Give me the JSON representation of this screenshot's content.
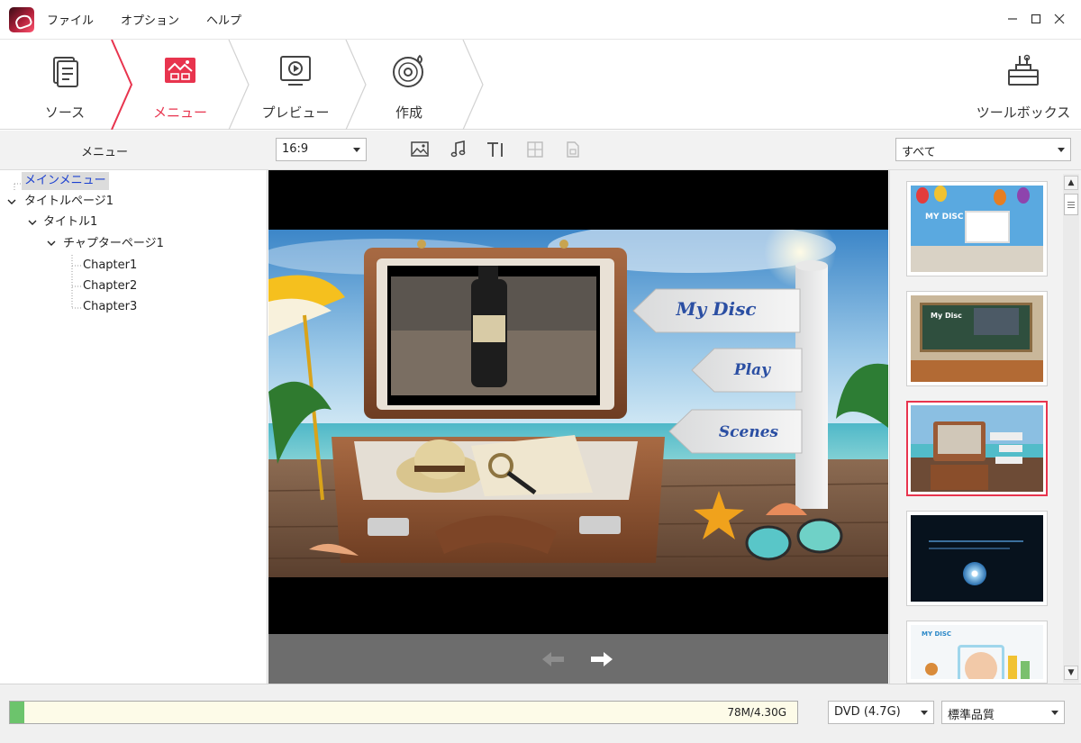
{
  "menu": {
    "file": "ファイル",
    "options": "オプション",
    "help": "ヘルプ"
  },
  "steps": {
    "source": "ソース",
    "menu": "メニュー",
    "preview": "プレビュー",
    "create": "作成",
    "toolbox": "ツールボックス",
    "active": "menu"
  },
  "left_panel": {
    "title": "メニュー"
  },
  "aspect_select": {
    "value": "16:9"
  },
  "filter_select": {
    "value": "すべて"
  },
  "tree": {
    "main_menu": "メインメニュー",
    "title_page": "タイトルページ1",
    "title": "タイトル1",
    "chapter_page": "チャプターページ1",
    "chapters": [
      "Chapter1",
      "Chapter2",
      "Chapter3"
    ]
  },
  "disc_menu": {
    "title": "My Disc",
    "play": "Play",
    "scenes": "Scenes"
  },
  "thumb_labels": {
    "t1": "MY DISC",
    "t2": "My Disc",
    "t5": "MY DISC"
  },
  "status": {
    "capacity_text": "78M/4.30G",
    "capacity_fraction": 0.018,
    "disc_type": "DVD (4.7G)",
    "quality": "標準品質"
  },
  "colors": {
    "accent": "#e8344e",
    "progress_fill": "#6cc46c",
    "selected_tree_text": "#1a3fd0"
  }
}
